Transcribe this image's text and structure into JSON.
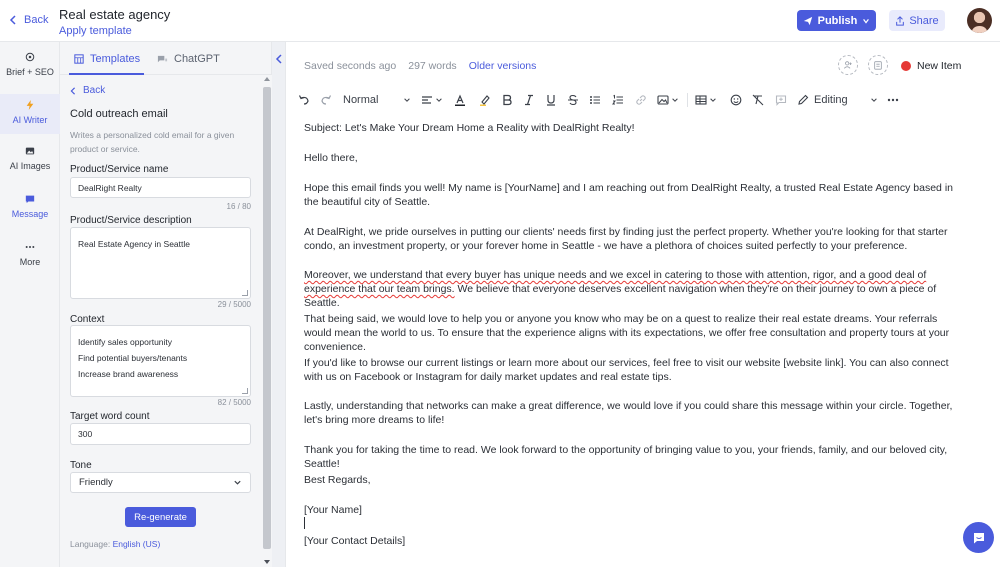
{
  "header": {
    "back_label": "Back",
    "doc_title": "Real estate agency",
    "apply_template": "Apply template",
    "publish_label": "Publish",
    "share_label": "Share"
  },
  "rail": {
    "items": [
      {
        "label": "Brief + SEO",
        "icon": "target-icon"
      },
      {
        "label": "AI Writer",
        "icon": "lightning-icon",
        "active": true
      },
      {
        "label": "AI Images",
        "icon": "image-icon"
      },
      {
        "label": "Message",
        "icon": "message-icon"
      },
      {
        "label": "More",
        "icon": "more-icon"
      }
    ]
  },
  "panel": {
    "tabs": [
      {
        "label": "Templates",
        "active": true
      },
      {
        "label": "ChatGPT"
      }
    ],
    "back_label": "Back",
    "heading": "Cold outreach email",
    "description": "Writes a personalized cold email for a given product or service.",
    "fields": {
      "product_name": {
        "label": "Product/Service name",
        "value": "DealRight Realty",
        "counter": "16 / 80"
      },
      "product_desc": {
        "label": "Product/Service description",
        "value": "Real Estate Agency in Seattle",
        "counter": "29 / 5000"
      },
      "context": {
        "label": "Context",
        "lines": [
          "Identify sales opportunity",
          "Find potential buyers/tenants",
          "Increase brand awareness"
        ],
        "counter": "82 / 5000"
      },
      "word_count": {
        "label": "Target word count",
        "value": "300"
      },
      "tone": {
        "label": "Tone",
        "value": "Friendly"
      }
    },
    "regenerate_label": "Re-generate",
    "language_label": "Language:",
    "language_value": "English (US)"
  },
  "editor": {
    "saved": "Saved seconds ago",
    "words": "297 words",
    "older_versions": "Older versions",
    "new_item": "New Item",
    "toolbar": {
      "style": "Normal",
      "mode": "Editing"
    },
    "paragraphs": {
      "p1": "Subject: Let's Make Your Dream  Home a Reality with DealRight Realty!",
      "p2": "Hello there,",
      "p3": "Hope this email finds you well! My name is [YourName] and I am reaching out from DealRight Realty, a trusted Real Estate Agency based in the beautiful city of Seattle.",
      "p4": "At DealRight, we pride ourselves in putting our clients' needs first by finding just the perfect property. Whether you're looking for that starter condo, an investment property, or your forever home in Seattle - we have a plethora of choices suited perfectly to your preference.",
      "p5a": "Moreover, we understand that every buyer has unique needs and we excel in catering to those with attention, rigor, and a good deal of experience that our team brings.",
      "p5b": " We believe that everyone deserves excellent navigation when they're on their journey to own a piece of Seattle.",
      "p6": "That being said, we would love to help you or anyone you know who may be on a quest to realize their real estate dreams. Your referrals would mean the world to us. To ensure that the experience aligns with its expectations, we offer free consultation and property tours at your convenience.",
      "p7": "If you'd like to browse our current listings or learn more about our services, feel free to visit our website [website link]. You can also connect with us on Facebook or Instagram for daily market updates and real estate tips.",
      "p8": "Lastly, understanding that networks can make a great difference, we would love if you could share this message within your circle. Together, let's bring more dreams to life!",
      "p9": "Thank you for taking the time to read. We look forward to the opportunity of bringing value to you, your friends, family, and our beloved city, Seattle!",
      "p10": "Best Regards,",
      "p11": "[Your Name]",
      "p12": "[Your Contact Details]"
    }
  },
  "colors": {
    "accent": "#4a5bdc",
    "status_red": "#e53935"
  }
}
